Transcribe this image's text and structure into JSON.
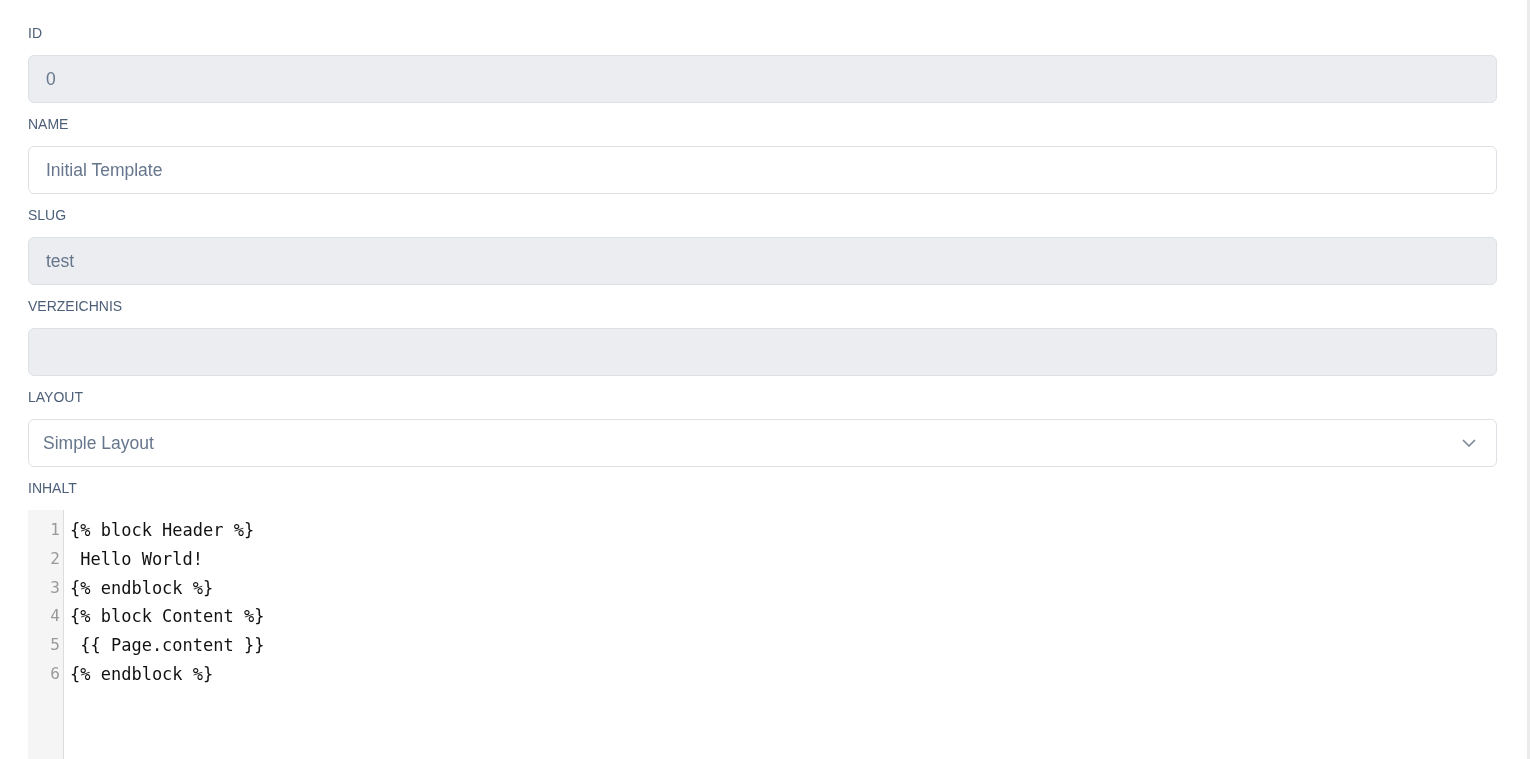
{
  "fields": [
    {
      "kind": "text",
      "label": "ID",
      "value": "0",
      "disabled": true
    },
    {
      "kind": "text",
      "label": "NAME",
      "value": "Initial Template",
      "disabled": false
    },
    {
      "kind": "text",
      "label": "SLUG",
      "value": "test",
      "disabled": true
    },
    {
      "kind": "text",
      "label": "VERZEICHNIS",
      "disabled": true
    },
    {
      "kind": "select",
      "label": "LAYOUT",
      "value": "Simple Layout"
    },
    {
      "kind": "code",
      "label": "INHALT",
      "lines": [
        {
          "number": "1",
          "text": "{% block Header %}"
        },
        {
          "number": "2",
          "text": " Hello World!"
        },
        {
          "number": "3",
          "text": "{% endblock %}"
        },
        {
          "number": "4",
          "text": "{% block Content %}"
        },
        {
          "number": "5",
          "text": " {{ Page.content }}"
        },
        {
          "number": "6",
          "text": "{% endblock %}"
        }
      ]
    }
  ]
}
